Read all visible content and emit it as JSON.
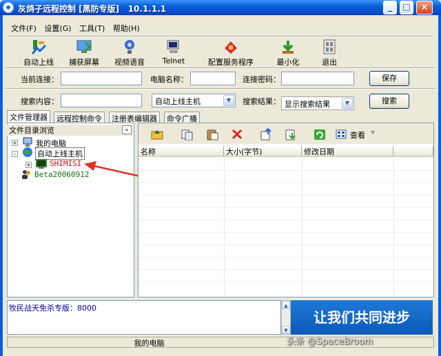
{
  "window": {
    "title": "灰鸽子远程控制 [黑防专版]   10.1.1.1",
    "min_glyph": "_",
    "max_glyph": "□",
    "close_glyph": "×",
    "app_glyph": "◆"
  },
  "menu": [
    {
      "label": "文件(F)"
    },
    {
      "label": "设置(G)"
    },
    {
      "label": "工具(T)"
    },
    {
      "label": "帮助(H)"
    }
  ],
  "toolbar": [
    {
      "label": "自动上线",
      "icon": "auto-online-icon"
    },
    {
      "label": "捕获屏幕",
      "icon": "capture-screen-icon"
    },
    {
      "label": "视频语音",
      "icon": "video-voice-icon"
    },
    {
      "label": "Telnet",
      "icon": "telnet-icon"
    },
    {
      "label": "配置服务程序",
      "icon": "config-server-icon"
    },
    {
      "label": "最小化",
      "icon": "minimize-icon"
    },
    {
      "label": "退出",
      "icon": "exit-icon"
    }
  ],
  "connection": {
    "current_label": "当前连接：",
    "current_value": "",
    "computer_label": "电脑名称：",
    "computer_value": "",
    "password_label": "连接密码：",
    "password_value": "",
    "save_button": "保存"
  },
  "search": {
    "content_label": "搜索内容：",
    "content_value": "",
    "scope_value": "自动上线主机",
    "result_label": "搜索结果：",
    "result_value": "显示搜索结果",
    "search_button": "搜索"
  },
  "tabs": [
    {
      "label": "文件管理器",
      "active": true
    },
    {
      "label": "远程控制命令",
      "active": false
    },
    {
      "label": "注册表编辑器",
      "active": false
    },
    {
      "label": "命令广播",
      "active": false
    }
  ],
  "tree": {
    "header": "文件目录浏览",
    "collapse_glyph": "«",
    "items": [
      {
        "label": "我的电脑"
      },
      {
        "label": "自动上线主机"
      },
      {
        "label": "SHIMISI"
      },
      {
        "label": "Beta20060912"
      }
    ]
  },
  "files": {
    "view_label": "查看",
    "columns": [
      "名称",
      "大小(字节)",
      "修改日期"
    ]
  },
  "log": {
    "text": "牧民战天免杀专版：8000"
  },
  "banner": {
    "text": "让我们共同进步"
  },
  "status": {
    "cell": "我的电脑"
  },
  "watermark": {
    "text": "头条 @SpaceBroom"
  },
  "colors": {
    "title_bar": "#0a5fd8",
    "annotation_arrow": "#e03020",
    "banner_bg": "#1f78d6"
  }
}
